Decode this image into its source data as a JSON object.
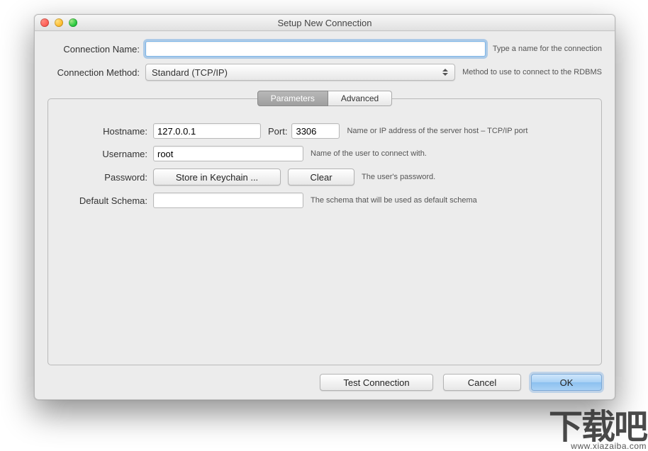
{
  "window": {
    "title": "Setup New Connection"
  },
  "top_form": {
    "name_label": "Connection Name:",
    "name_value": "",
    "name_hint": "Type a name for the connection",
    "method_label": "Connection Method:",
    "method_value": "Standard (TCP/IP)",
    "method_hint": "Method to use to connect to the RDBMS"
  },
  "tabs": {
    "parameters": "Parameters",
    "advanced": "Advanced",
    "active": "parameters"
  },
  "params": {
    "hostname_label": "Hostname:",
    "hostname_value": "127.0.0.1",
    "port_label": "Port:",
    "port_value": "3306",
    "host_hint": "Name or IP address of the server host – TCP/IP port",
    "username_label": "Username:",
    "username_value": "root",
    "username_hint": "Name of the user to connect with.",
    "password_label": "Password:",
    "store_btn": "Store in Keychain ...",
    "clear_btn": "Clear",
    "password_hint": "The user's password.",
    "schema_label": "Default Schema:",
    "schema_value": "",
    "schema_hint": "The schema that will be used as default schema"
  },
  "buttons": {
    "test": "Test Connection",
    "cancel": "Cancel",
    "ok": "OK"
  },
  "watermark": {
    "big": "下载吧",
    "url": "www.xiazaiba.com"
  }
}
